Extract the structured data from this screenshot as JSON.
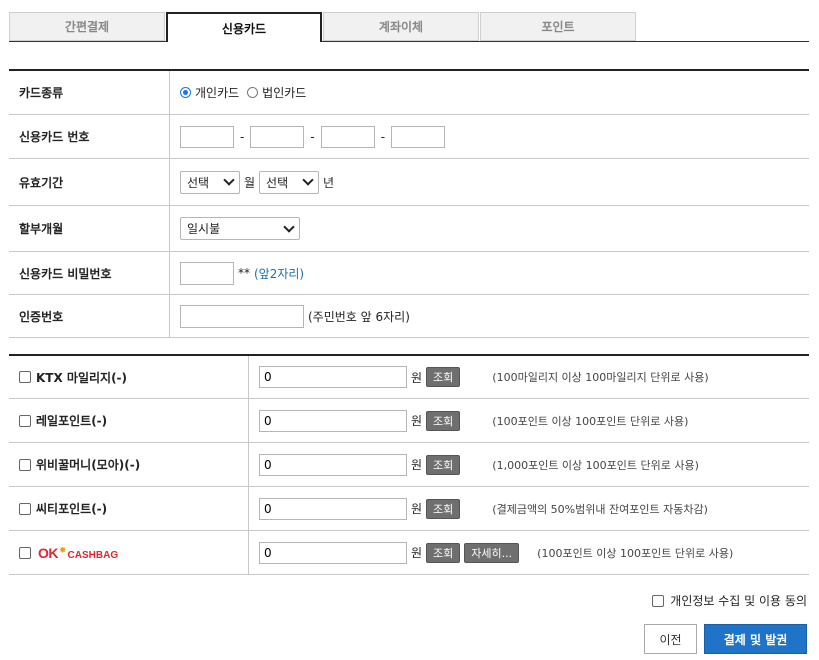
{
  "tabs": [
    {
      "label": "간편결제",
      "active": false
    },
    {
      "label": "신용카드",
      "active": true
    },
    {
      "label": "계좌이체",
      "active": false
    },
    {
      "label": "포인트",
      "active": false
    }
  ],
  "card_form": {
    "card_type": {
      "label": "카드종류",
      "options": [
        "개인카드",
        "법인카드"
      ],
      "selected": "개인카드"
    },
    "card_number": {
      "label": "신용카드 번호",
      "separator": "-",
      "parts": [
        "",
        "",
        "",
        ""
      ]
    },
    "expiry": {
      "label": "유효기간",
      "month_value": "선택",
      "month_unit": "월",
      "year_value": "선택",
      "year_unit": "년"
    },
    "installment": {
      "label": "할부개월",
      "value": "일시불"
    },
    "password": {
      "label": "신용카드 비밀번호",
      "value": "",
      "suffix": "**",
      "hint": "(앞2자리)"
    },
    "auth": {
      "label": "인증번호",
      "value": "",
      "hint": "(주민번호 앞 6자리)"
    }
  },
  "points": {
    "unit": "원",
    "lookup_label": "조회",
    "rows": [
      {
        "label": "KTX 마일리지(-)",
        "value": "0",
        "note": "(100마일리지 이상 100마일리지 단위로 사용)"
      },
      {
        "label": "레일포인트(-)",
        "value": "0",
        "note": "(100포인트 이상 100포인트 단위로 사용)"
      },
      {
        "label": "위비꿀머니(모아)(-)",
        "value": "0",
        "note": "(1,000포인트 이상 100포인트 단위로 사용)"
      },
      {
        "label": "씨티포인트(-)",
        "value": "0",
        "note": "(결제금액의 50%범위내 잔여포인트 자동차감)"
      }
    ],
    "ok_cashbag": {
      "logo_ok": "OK",
      "logo_text": "CASHBAG",
      "value": "0",
      "detail_label": "자세히...",
      "note": "(100포인트 이상 100포인트 단위로 사용)"
    }
  },
  "consent_label": "개인정보 수집 및 이용 동의",
  "buttons": {
    "prev": "이전",
    "pay": "결제 및 발권"
  },
  "colors": {
    "accent": "#1a73e8",
    "primary_button": "#1f74c7",
    "hint": "#1a6fb3",
    "ok_red": "#e0262f"
  }
}
